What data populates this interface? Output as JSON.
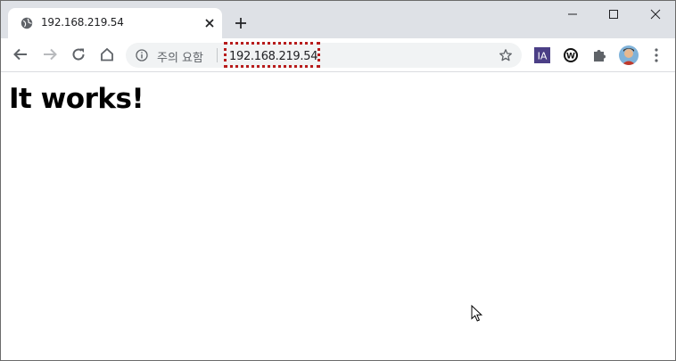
{
  "tab": {
    "title": "192.168.219.54"
  },
  "omnibox": {
    "security_text": "주의 요함",
    "url": "192.168.219.54"
  },
  "extensions": {
    "ia_label": "IA",
    "w_label": "W"
  },
  "page": {
    "heading": "It works!"
  },
  "colors": {
    "tabstrip": "#dee1e6",
    "url_highlight": "#b71c1c",
    "ia_badge": "#4b3f86"
  },
  "icons": [
    "globe-icon",
    "close-icon",
    "plus-icon",
    "minimize-icon",
    "maximize-icon",
    "window-close-icon",
    "back-arrow-icon",
    "forward-arrow-icon",
    "reload-icon",
    "home-icon",
    "info-icon",
    "star-icon",
    "ia-extension-icon",
    "w-extension-icon",
    "puzzle-icon",
    "avatar",
    "kebab-menu-icon",
    "mouse-cursor-icon"
  ]
}
